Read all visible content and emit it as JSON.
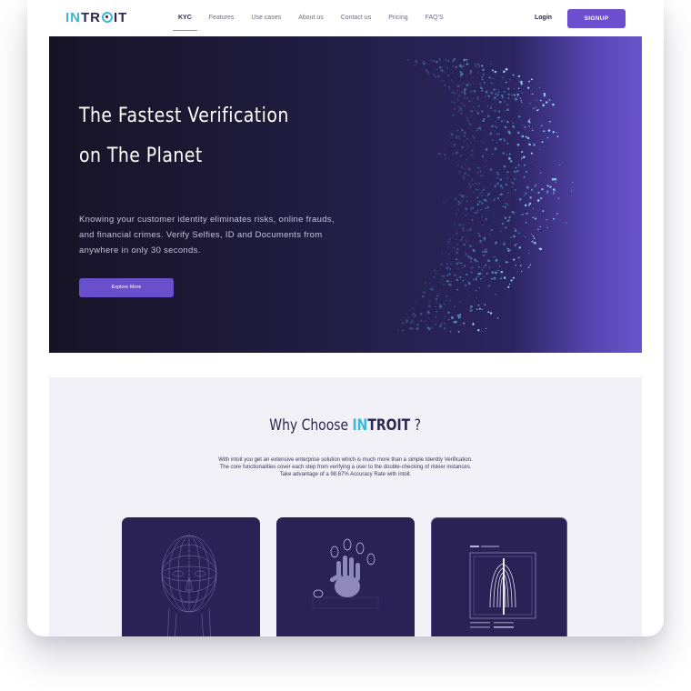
{
  "nav": {
    "logo": {
      "part1": "IN",
      "part2": "TR",
      "part3": "IT"
    },
    "items": [
      {
        "label": "KYC",
        "active": true
      },
      {
        "label": "Features"
      },
      {
        "label": "Use cases"
      },
      {
        "label": "About us"
      },
      {
        "label": "Contact us"
      },
      {
        "label": "Pricing"
      },
      {
        "label": "FAQ'S"
      }
    ],
    "login": "Login",
    "signup": "SIGNUP"
  },
  "hero": {
    "title_line1": "The Fastest Verification",
    "title_line2": "on The Planet",
    "description": "Knowing your customer identity eliminates risks, online frauds, and financial crimes. Verify Selfies, ID and Documents from anywhere in only 30 seconds.",
    "cta": "Explore More"
  },
  "why": {
    "title_prefix": "Why Choose ",
    "brand_in": "IN",
    "brand_rest": "TROIT",
    "title_suffix": " ?",
    "description_line1": "With intoit you get an extensive enterprise solution which is much more than a simple Identity Verification.",
    "description_line2": "The core functionalities cover each step from verifying a user to the double-checking of riskier instances.",
    "description_line3": "Take advantage of a 98.67% Accuracy Rate with intoit.",
    "cards": [
      {
        "icon": "face-mesh-icon"
      },
      {
        "icon": "fingerprint-hand-icon"
      },
      {
        "icon": "fingerprint-scan-icon"
      }
    ]
  },
  "colors": {
    "accent": "#6b4fcf",
    "brand_cyan": "#3fb6d8",
    "dark_navy": "#2b2750",
    "hero_dark": "#171326",
    "section_bg": "#f2f1f8"
  }
}
